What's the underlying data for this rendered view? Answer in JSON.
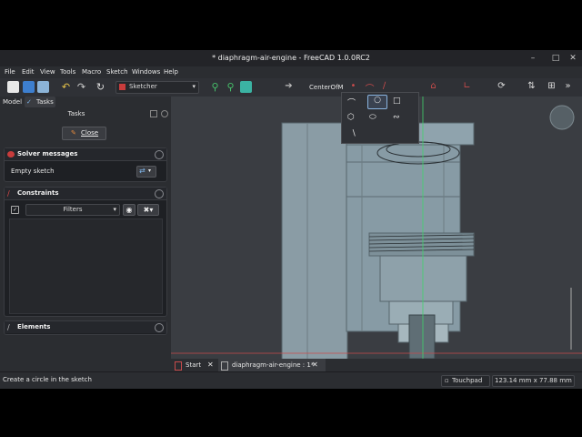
{
  "window": {
    "title": "* diaphragm-air-engine - FreeCAD 1.0.0RC2"
  },
  "menu": [
    "File",
    "Edit",
    "View",
    "Tools",
    "Macro",
    "Sketch",
    "Windows",
    "Help"
  ],
  "toolbar": {
    "workbench": "Sketcher",
    "snap_label": "CenterOfM"
  },
  "panel": {
    "tab_model": "Model",
    "tab_tasks": "Tasks",
    "header": "Tasks",
    "close_label": "Close",
    "solver": {
      "title": "Solver messages",
      "message": "Empty sketch"
    },
    "constraints": {
      "title": "Constraints",
      "filter_label": "Filters"
    },
    "elements": {
      "title": "Elements"
    }
  },
  "doc_tabs": [
    {
      "label": "Start"
    },
    {
      "label": "diaphragm-air-engine : 1*"
    }
  ],
  "status": {
    "hint": "Create a circle in the sketch",
    "navigation": "Touchpad",
    "dimensions": "123.14 mm x 77.88 mm"
  },
  "colors": {
    "accent": "#4a9fe8",
    "x_axis": "#c84b4b",
    "y_axis": "#3fd46b",
    "part": "#8fa3ad"
  }
}
